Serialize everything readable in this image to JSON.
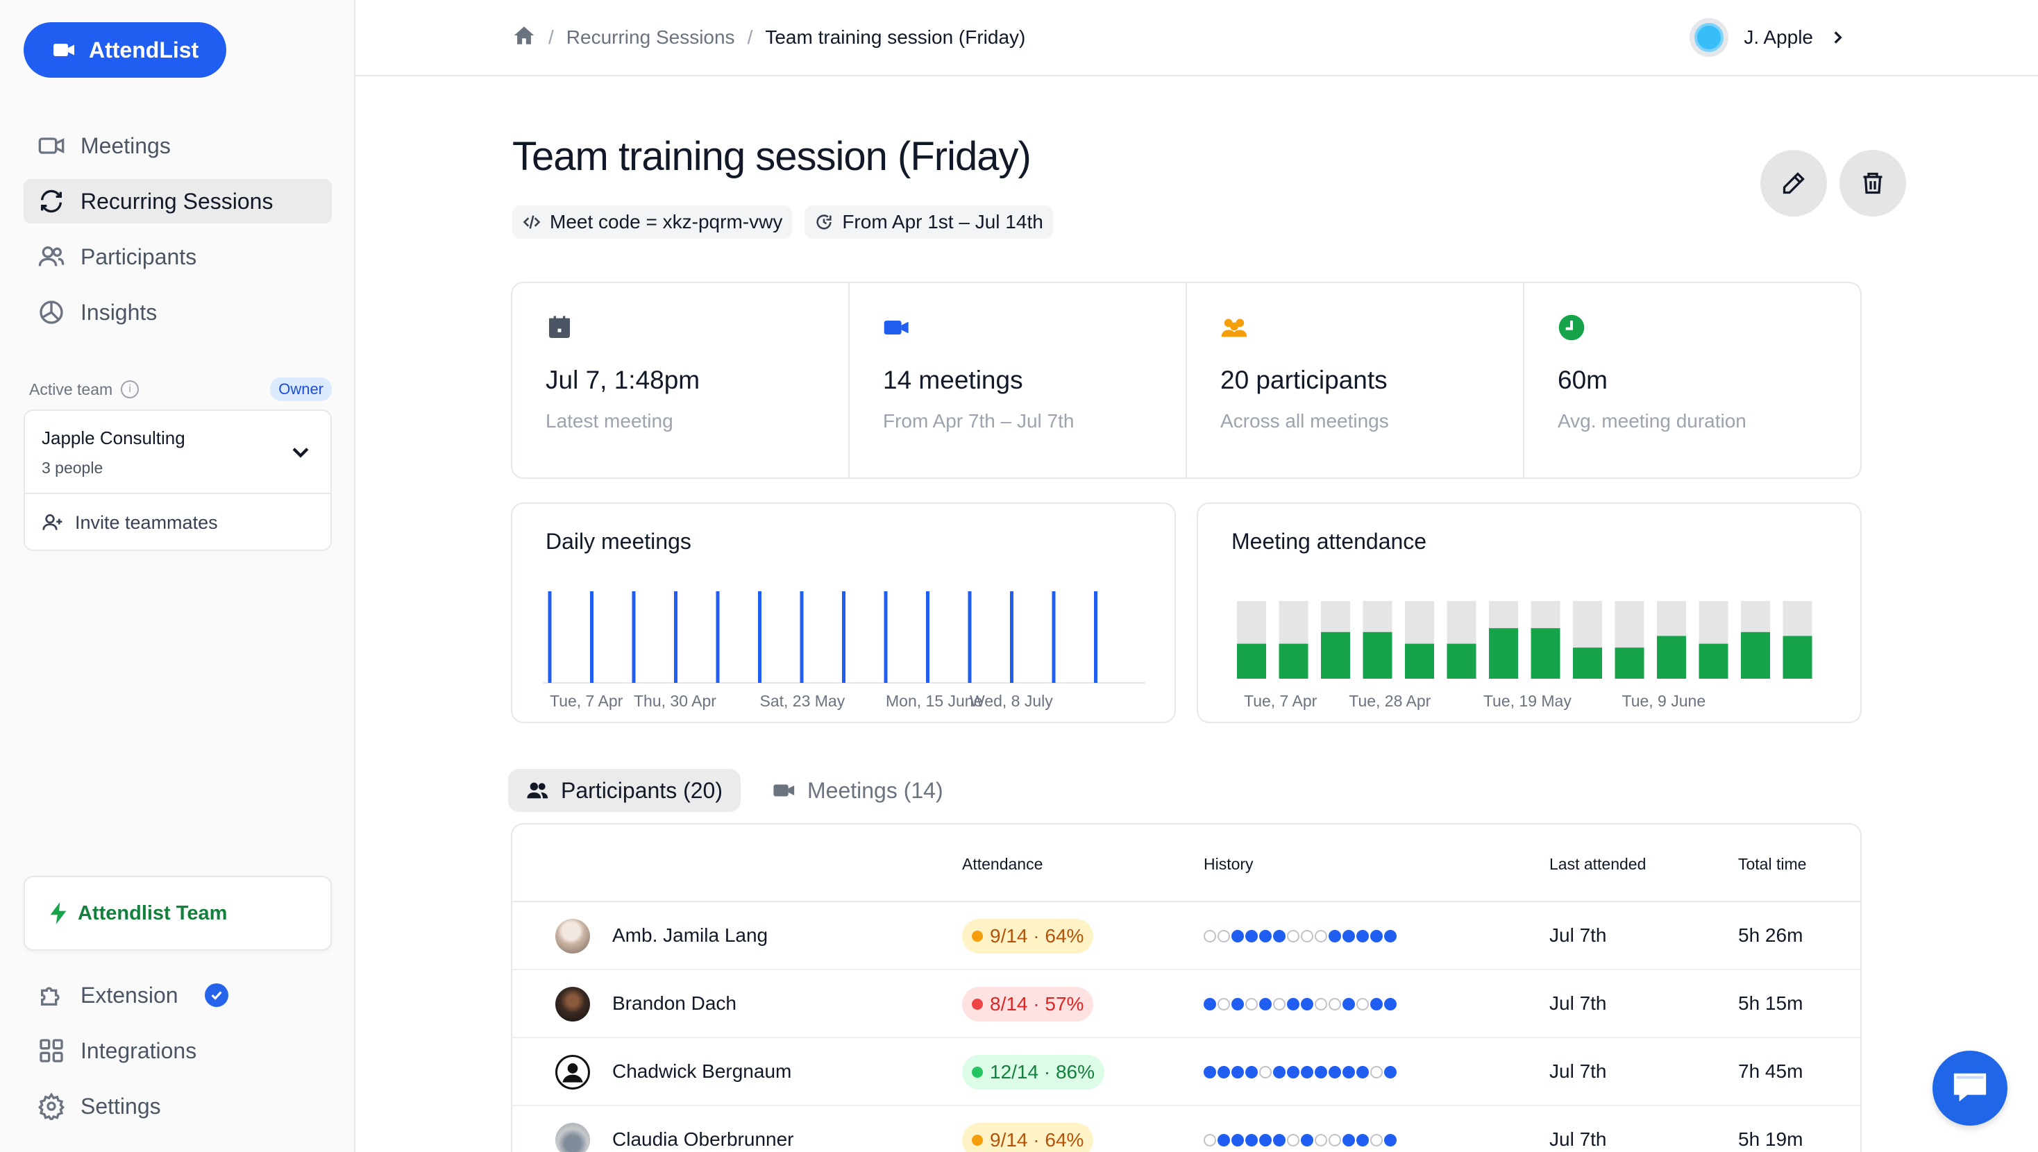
{
  "app": {
    "brand": "AttendList"
  },
  "sidebar": {
    "nav": [
      {
        "label": "Meetings",
        "icon": "video-icon"
      },
      {
        "label": "Recurring Sessions",
        "icon": "refresh-icon",
        "active": true
      },
      {
        "label": "Participants",
        "icon": "users-icon"
      },
      {
        "label": "Insights",
        "icon": "pie-chart-icon"
      }
    ],
    "active_team_label": "Active team",
    "owner_badge": "Owner",
    "team_name": "Japple Consulting",
    "team_count": "3 people",
    "invite_label": "Invite teammates",
    "plan_label": "Attendlist Team",
    "bottom_nav": [
      {
        "label": "Extension",
        "icon": "puzzle-icon",
        "verified": true
      },
      {
        "label": "Integrations",
        "icon": "grid-icon"
      },
      {
        "label": "Settings",
        "icon": "gear-icon"
      }
    ]
  },
  "breadcrumb": {
    "c1": "Recurring Sessions",
    "c2": "Team training session (Friday)"
  },
  "user": {
    "name": "J. Apple"
  },
  "page": {
    "title": "Team training session (Friday)",
    "meet_code": "Meet code = xkz-pqrm-vwy",
    "date_range": "From Apr 1st – Jul 14th"
  },
  "stats": [
    {
      "value": "Jul 7, 1:48pm",
      "sub": "Latest meeting",
      "icon": "calendar-icon"
    },
    {
      "value": "14 meetings",
      "sub": "From Apr 7th – Jul 7th",
      "icon": "video-icon"
    },
    {
      "value": "20 participants",
      "sub": "Across all meetings",
      "icon": "people-icon"
    },
    {
      "value": "60m",
      "sub": "Avg. meeting duration",
      "icon": "clock-icon"
    }
  ],
  "colors": {
    "accent": "#1f5ef0",
    "green": "#16a34a",
    "amber": "#f59e0b",
    "red": "#ef4444",
    "grey_bar": "#e5e5e5"
  },
  "chart_data": [
    {
      "type": "bar",
      "title": "Daily meetings",
      "values": [
        1,
        1,
        1,
        1,
        1,
        1,
        1,
        1,
        1,
        1,
        1,
        1,
        1,
        1
      ],
      "tick_labels": [
        "Tue, 7 Apr",
        "Thu, 30 Apr",
        "Sat, 23 May",
        "Mon, 15 June",
        "Wed, 8 July"
      ]
    },
    {
      "type": "bar",
      "title": "Meeting attendance",
      "series": [
        {
          "name": "attended",
          "values": [
            9,
            9,
            12,
            12,
            9,
            9,
            13,
            13,
            8,
            8,
            11,
            9,
            12,
            11
          ]
        },
        {
          "name": "total",
          "values": [
            20,
            20,
            20,
            20,
            20,
            20,
            20,
            20,
            20,
            20,
            20,
            20,
            20,
            20
          ]
        }
      ],
      "tick_labels": [
        "Tue, 7 Apr",
        "Tue, 28 Apr",
        "Tue, 19 May",
        "Tue, 9 June"
      ]
    }
  ],
  "tabs": [
    {
      "label": "Participants (20)",
      "active": true
    },
    {
      "label": "Meetings (14)"
    }
  ],
  "table": {
    "headers": {
      "attendance": "Attendance",
      "history": "History",
      "last": "Last attended",
      "total": "Total time"
    },
    "rows": [
      {
        "name": "Amb. Jamila Lang",
        "attendance": "9/14 · 64%",
        "level": "amber",
        "history": [
          0,
          0,
          1,
          1,
          1,
          1,
          0,
          0,
          0,
          1,
          1,
          1,
          1,
          1
        ],
        "last": "Jul 7th",
        "total": "5h 26m"
      },
      {
        "name": "Brandon Dach",
        "attendance": "8/14 · 57%",
        "level": "red",
        "history": [
          1,
          0,
          1,
          0,
          1,
          0,
          1,
          1,
          0,
          0,
          1,
          0,
          1,
          1
        ],
        "last": "Jul 7th",
        "total": "5h 15m"
      },
      {
        "name": "Chadwick Bergnaum",
        "attendance": "12/14 · 86%",
        "level": "green",
        "history": [
          1,
          1,
          1,
          1,
          0,
          1,
          1,
          1,
          1,
          1,
          1,
          1,
          0,
          1
        ],
        "last": "Jul 7th",
        "total": "7h 45m"
      },
      {
        "name": "Claudia Oberbrunner",
        "attendance": "9/14 · 64%",
        "level": "amber",
        "history": [
          0,
          1,
          1,
          1,
          1,
          1,
          0,
          1,
          0,
          0,
          1,
          1,
          0,
          1
        ],
        "last": "Jul 7th",
        "total": "5h 19m"
      }
    ]
  }
}
